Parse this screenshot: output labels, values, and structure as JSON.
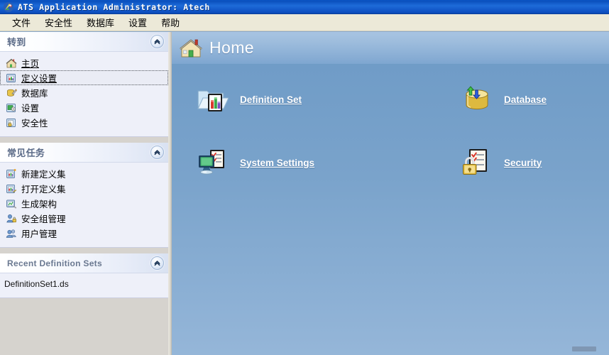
{
  "window": {
    "title": "ATS Application Administrator: Atech",
    "icon": "app-icon"
  },
  "menubar": {
    "items": [
      {
        "label": "文件",
        "name": "menu-file"
      },
      {
        "label": "安全性",
        "name": "menu-security"
      },
      {
        "label": "数据库",
        "name": "menu-database"
      },
      {
        "label": "设置",
        "name": "menu-settings"
      },
      {
        "label": "帮助",
        "name": "menu-help"
      }
    ]
  },
  "sidebar": {
    "panels": [
      {
        "title": "转到",
        "collapse_icon": "chevron-up-icon",
        "items": [
          {
            "label": "主页",
            "icon": "home-small-icon",
            "link": true,
            "focused": false
          },
          {
            "label": "定义设置",
            "icon": "definition-set-small-icon",
            "link": true,
            "focused": true
          },
          {
            "label": "数据库",
            "icon": "database-small-icon",
            "link": false,
            "focused": false
          },
          {
            "label": "设置",
            "icon": "settings-small-icon",
            "link": false,
            "focused": false
          },
          {
            "label": "安全性",
            "icon": "security-small-icon",
            "link": false,
            "focused": false
          }
        ]
      },
      {
        "title": "常见任务",
        "collapse_icon": "chevron-up-icon",
        "items": [
          {
            "label": "新建定义集",
            "icon": "new-definition-icon",
            "link": false,
            "focused": false
          },
          {
            "label": "打开定义集",
            "icon": "open-definition-icon",
            "link": false,
            "focused": false
          },
          {
            "label": "生成架构",
            "icon": "generate-schema-icon",
            "link": false,
            "focused": false
          },
          {
            "label": "安全组管理",
            "icon": "security-group-icon",
            "link": false,
            "focused": false
          },
          {
            "label": "用户管理",
            "icon": "user-management-icon",
            "link": false,
            "focused": false
          }
        ]
      },
      {
        "title": "Recent Definition Sets",
        "collapse_icon": "chevron-up-icon",
        "recent": [
          {
            "label": "DefinitionSet1.ds"
          }
        ]
      }
    ]
  },
  "content": {
    "header": {
      "title": "Home",
      "icon": "home-icon"
    },
    "tiles": [
      {
        "label": "Definition Set",
        "icon": "definition-set-icon"
      },
      {
        "label": "Database",
        "icon": "database-icon"
      },
      {
        "label": "System Settings",
        "icon": "system-settings-icon"
      },
      {
        "label": "Security",
        "icon": "security-icon"
      }
    ]
  },
  "colors": {
    "titlebar_blue": "#0a50bd",
    "menubar_bg": "#ece9d8",
    "panel_body": "#eef0f9",
    "panel_title_text": "#5a6a87",
    "content_blue": "#7aa3cb",
    "sidebar_filler": "#d6d3ce"
  }
}
